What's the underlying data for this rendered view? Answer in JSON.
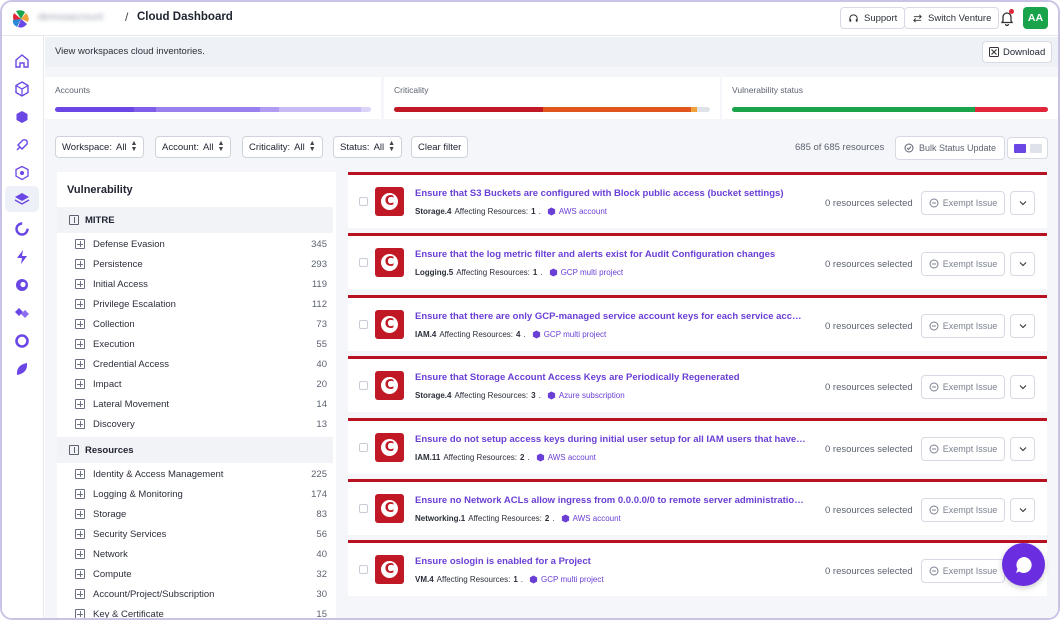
{
  "header": {
    "account_name": "demosaccount",
    "separator": "/",
    "title": "Cloud Dashboard",
    "support_label": "Support",
    "switch_label": "Switch Venture",
    "avatar_initials": "AA"
  },
  "rail": {
    "items": [
      "home-icon",
      "cube-icon",
      "hexagon-icon",
      "rocket-icon",
      "shield-icon",
      "layers-icon",
      "ring-icon",
      "bolt-icon",
      "swirl-icon",
      "diamond-icon",
      "circle-icon",
      "leaf-icon"
    ],
    "active_index": 5
  },
  "subheader": {
    "text": "View workspaces cloud inventories.",
    "download_label": "Download"
  },
  "metrics": [
    {
      "label": "Accounts",
      "segments": [
        {
          "color": "#6a46e5",
          "value": 0.25
        },
        {
          "color": "#7f5ee9",
          "value": 0.07
        },
        {
          "color": "#9a80ee",
          "value": 0.33
        },
        {
          "color": "#b09cf2",
          "value": 0.06
        },
        {
          "color": "#c8bbf6",
          "value": 0.26
        },
        {
          "color": "#dcd3f9",
          "value": 0.03
        }
      ]
    },
    {
      "label": "Criticality",
      "segments": [
        {
          "color": "#c01824",
          "value": 0.47
        },
        {
          "color": "#e0561d",
          "value": 0.47
        },
        {
          "color": "#f0a23c",
          "value": 0.02
        },
        {
          "color": "#dfe2e8",
          "value": 0.04
        }
      ]
    },
    {
      "label": "Vulnerability status",
      "segments": [
        {
          "color": "#19a34a",
          "value": 0.77
        },
        {
          "color": "#e0263a",
          "value": 0.23
        }
      ]
    }
  ],
  "filters": {
    "workspace": "Workspace:",
    "workspace_val": "All",
    "account": "Account:",
    "account_val": "All",
    "criticality": "Criticality:",
    "criticality_val": "All",
    "status": "Status:",
    "status_val": "All",
    "clear": "Clear filter",
    "count": "685 of 685 resources",
    "bulk": "Bulk Status Update"
  },
  "vuln_panel": {
    "title": "Vulnerability",
    "groups": [
      {
        "label": "MITRE",
        "items": [
          {
            "label": "Defense Evasion",
            "count": "345"
          },
          {
            "label": "Persistence",
            "count": "293"
          },
          {
            "label": "Initial Access",
            "count": "119"
          },
          {
            "label": "Privilege Escalation",
            "count": "112"
          },
          {
            "label": "Collection",
            "count": "73"
          },
          {
            "label": "Execution",
            "count": "55"
          },
          {
            "label": "Credential Access",
            "count": "40"
          },
          {
            "label": "Impact",
            "count": "20"
          },
          {
            "label": "Lateral Movement",
            "count": "14"
          },
          {
            "label": "Discovery",
            "count": "13"
          }
        ]
      },
      {
        "label": "Resources",
        "items": [
          {
            "label": "Identity & Access Management",
            "count": "225"
          },
          {
            "label": "Logging & Monitoring",
            "count": "174"
          },
          {
            "label": "Storage",
            "count": "83"
          },
          {
            "label": "Security Services",
            "count": "56"
          },
          {
            "label": "Network",
            "count": "40"
          },
          {
            "label": "Compute",
            "count": "32"
          },
          {
            "label": "Account/Project/Subscription",
            "count": "30"
          },
          {
            "label": "Key & Certificate",
            "count": "15"
          }
        ]
      }
    ]
  },
  "issues": [
    {
      "title": "Ensure that S3 Buckets are configured with Block public access (bucket settings)",
      "rule": "Storage.4",
      "affecting": "Affecting Resources:",
      "count": "1",
      "provider": "AWS account",
      "selected": "0 resources selected",
      "exempt": "Exempt Issue"
    },
    {
      "title": "Ensure that the log metric filter and alerts exist for Audit Configuration changes",
      "rule": "Logging.5",
      "affecting": "Affecting Resources:",
      "count": "1",
      "provider": "GCP multi project",
      "selected": "0 resources selected",
      "exempt": "Exempt Issue"
    },
    {
      "title": "Ensure that there are only GCP-managed service account keys for each service account",
      "rule": "IAM.4",
      "affecting": "Affecting Resources:",
      "count": "4",
      "provider": "GCP multi project",
      "selected": "0 resources selected",
      "exempt": "Exempt Issue"
    },
    {
      "title": "Ensure that Storage Account Access Keys are Periodically Regenerated",
      "rule": "Storage.4",
      "affecting": "Affecting Resources:",
      "count": "3",
      "provider": "Azure subscription",
      "selected": "0 resources selected",
      "exempt": "Exempt Issue"
    },
    {
      "title": "Ensure do not setup access keys during initial user setup for all IAM users that have a...",
      "rule": "IAM.11",
      "affecting": "Affecting Resources:",
      "count": "2",
      "provider": "AWS account",
      "selected": "0 resources selected",
      "exempt": "Exempt Issue"
    },
    {
      "title": "Ensure no Network ACLs allow ingress from 0.0.0.0/0 to remote server administration...",
      "rule": "Networking.1",
      "affecting": "Affecting Resources:",
      "count": "2",
      "provider": "AWS account",
      "selected": "0 resources selected",
      "exempt": "Exempt Issue"
    },
    {
      "title": "Ensure oslogin is enabled for a Project",
      "rule": "VM.4",
      "affecting": "Affecting Resources:",
      "count": "1",
      "provider": "GCP multi project",
      "selected": "0 resources selected",
      "exempt": "Exempt Issue"
    }
  ],
  "colors": {
    "accent": "#6a3fd6",
    "critical": "#c01824",
    "brand_green": "#19a34a"
  }
}
